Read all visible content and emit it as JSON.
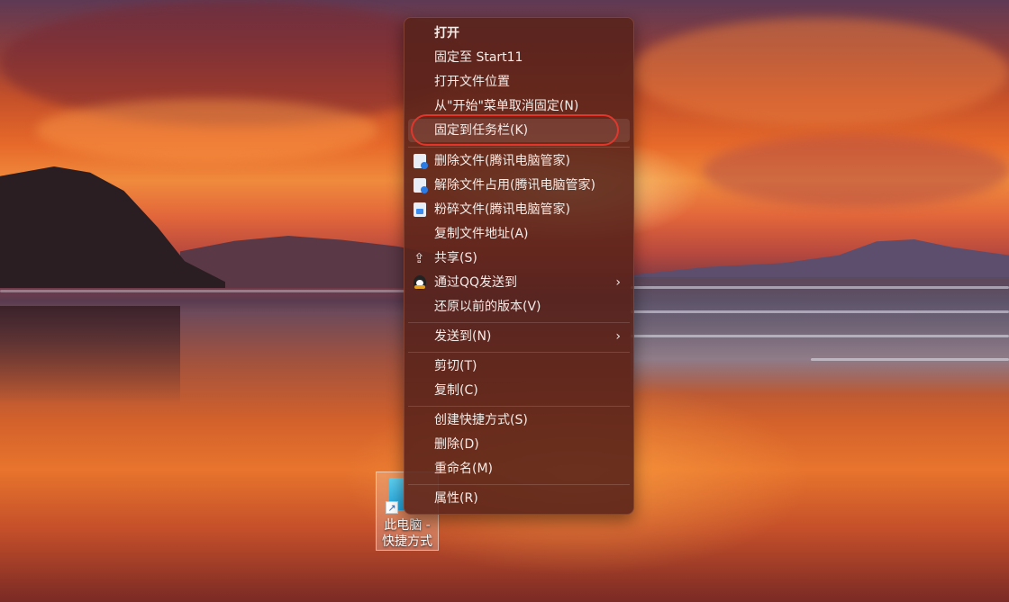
{
  "desktop": {
    "shortcut": {
      "label_line1": "此电脑 -",
      "label_line2": "快捷方式"
    }
  },
  "context_menu": {
    "items": [
      {
        "id": "open",
        "label": "打开",
        "bold": true
      },
      {
        "id": "pin-start11",
        "label": "固定至 Start11"
      },
      {
        "id": "open-location",
        "label": "打开文件位置"
      },
      {
        "id": "unpin-start",
        "label": "从\"开始\"菜单取消固定(N)"
      },
      {
        "id": "pin-taskbar",
        "label": "固定到任务栏(K)",
        "highlighted": true
      },
      {
        "id": "delete-file",
        "label": "删除文件(腾讯电脑管家)",
        "icon": "tencent-delete-icon"
      },
      {
        "id": "unlock-file",
        "label": "解除文件占用(腾讯电脑管家)",
        "icon": "tencent-unlock-icon"
      },
      {
        "id": "shred-file",
        "label": "粉碎文件(腾讯电脑管家)",
        "icon": "tencent-shred-icon"
      },
      {
        "id": "copy-path",
        "label": "复制文件地址(A)"
      },
      {
        "id": "share",
        "label": "共享(S)",
        "icon": "share-icon"
      },
      {
        "id": "send-qq",
        "label": "通过QQ发送到",
        "icon": "qq-icon",
        "submenu": true
      },
      {
        "id": "restore-versions",
        "label": "还原以前的版本(V)"
      },
      {
        "id": "send-to",
        "label": "发送到(N)",
        "submenu": true
      },
      {
        "id": "cut",
        "label": "剪切(T)"
      },
      {
        "id": "copy",
        "label": "复制(C)"
      },
      {
        "id": "create-shortcut",
        "label": "创建快捷方式(S)"
      },
      {
        "id": "delete",
        "label": "删除(D)"
      },
      {
        "id": "rename",
        "label": "重命名(M)"
      },
      {
        "id": "properties",
        "label": "属性(R)"
      }
    ],
    "submenu_glyph": "›",
    "share_glyph": "⇪",
    "highlight_ring_color": "#e4352a"
  }
}
